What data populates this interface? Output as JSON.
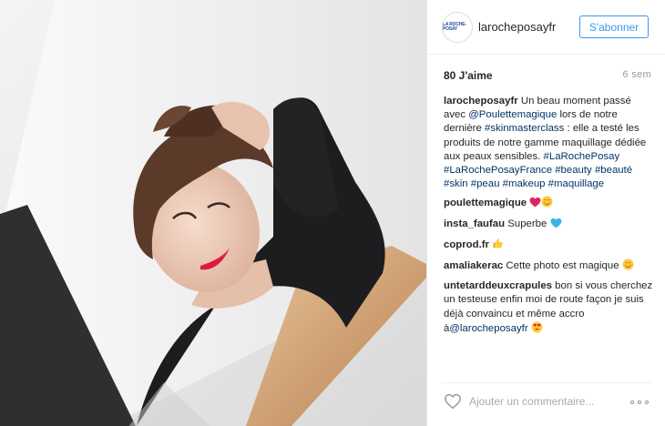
{
  "post": {
    "photo_alt": "",
    "account": {
      "username": "larocheposayfr",
      "avatar_text": "LA ROCHE-POSAY",
      "follow_label": "S'abonner"
    },
    "likes": "80 J'aime",
    "age": "6 sem",
    "comments": [
      {
        "user": "larocheposayfr",
        "parts": [
          {
            "t": " Un beau moment passé avec "
          },
          {
            "t": "@Poulettemagique",
            "link": true
          },
          {
            "t": " lors de notre dernière "
          },
          {
            "t": "#skinmasterclass",
            "link": true
          },
          {
            "t": " : elle a testé les produits de notre gamme maquillage dédiée aux peaux sensibles. "
          },
          {
            "t": "#LaRochePosay",
            "link": true
          },
          {
            "t": " "
          },
          {
            "t": "#LaRochePosayFrance",
            "link": true
          },
          {
            "t": " "
          },
          {
            "t": "#beauty",
            "link": true
          },
          {
            "t": " "
          },
          {
            "t": "#beauté",
            "link": true
          },
          {
            "t": " "
          },
          {
            "t": "#skin",
            "link": true
          },
          {
            "t": " "
          },
          {
            "t": "#peau",
            "link": true
          },
          {
            "t": " "
          },
          {
            "t": "#makeup",
            "link": true
          },
          {
            "t": " "
          },
          {
            "t": "#maquillage",
            "link": true
          }
        ]
      },
      {
        "user": "poulettemagique",
        "parts": [
          {
            "t": " "
          }
        ],
        "emojis": [
          "heart-red-emoji",
          "smile-blush-emoji"
        ]
      },
      {
        "user": "insta_faufau",
        "parts": [
          {
            "t": " Superbe "
          }
        ],
        "emojis": [
          "heart-blue-emoji"
        ]
      },
      {
        "user": "coprod.fr",
        "parts": [
          {
            "t": " "
          }
        ],
        "emojis": [
          "thumbs-up-emoji"
        ]
      },
      {
        "user": "amaliakerac",
        "parts": [
          {
            "t": " Cette photo est magique "
          }
        ],
        "emojis": [
          "smile-blush-emoji"
        ]
      },
      {
        "user": "untetarddeuxcrapules",
        "parts": [
          {
            "t": " bon si vous cherchez un testeuse enfin moi de route façon je suis déjà convaincu et même accro à"
          },
          {
            "t": "@larocheposayfr",
            "link": true
          },
          {
            "t": " "
          }
        ],
        "emojis": [
          "heart-eyes-emoji"
        ]
      }
    ],
    "comment_placeholder": "Ajouter un commentaire..."
  },
  "colors": {
    "accent": "#3897f0",
    "link": "#003569",
    "muted": "#999999"
  },
  "icons": {
    "like": "heart-outline-icon",
    "more": "more-options-icon"
  }
}
